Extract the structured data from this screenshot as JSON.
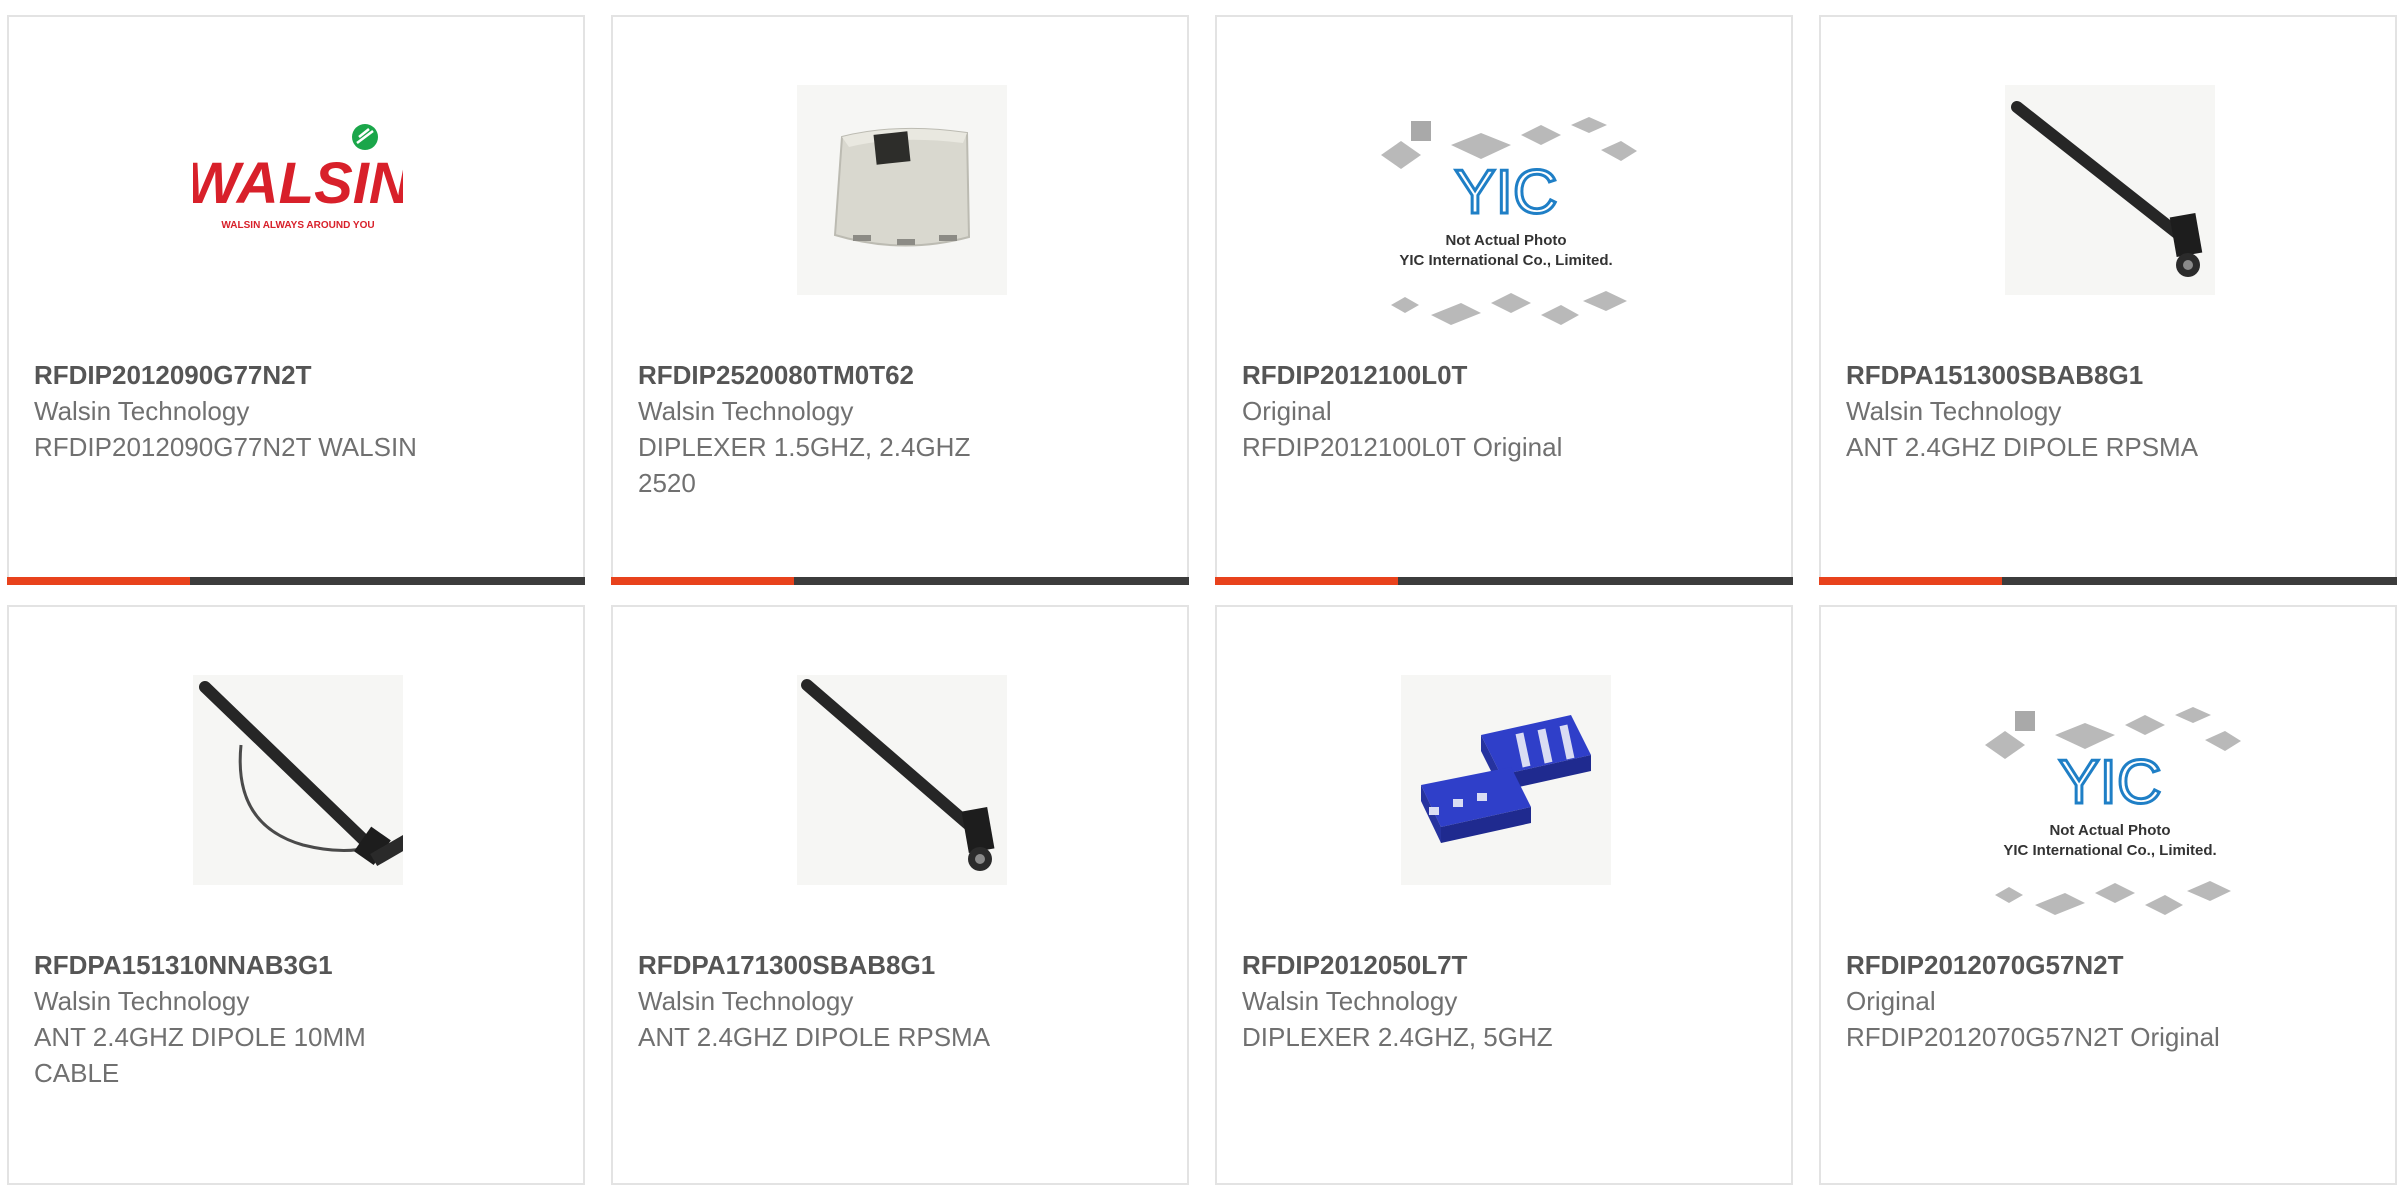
{
  "products": [
    {
      "part_number": "RFDIP2012090G77N2T",
      "manufacturer": "Walsin Technology",
      "description": "RFDIP2012090G77N2T WALSIN",
      "image": "walsin-logo",
      "logo": {
        "text": "WALSIN",
        "tagline": "WALSIN ALWAYS AROUND YOU"
      }
    },
    {
      "part_number": "RFDIP2520080TM0T62",
      "manufacturer": "Walsin Technology",
      "description": "DIPLEXER 1.5GHZ, 2.4GHZ 2520",
      "image": "ceramic-chip"
    },
    {
      "part_number": "RFDIP2012100L0T",
      "manufacturer": "Original",
      "description": "RFDIP2012100L0T Original",
      "image": "placeholder-yic",
      "placeholder": {
        "logo": "YIC",
        "line1": "Not Actual Photo",
        "line2": "YIC International Co., Limited."
      }
    },
    {
      "part_number": "RFDPA151300SBAB8G1",
      "manufacturer": "Walsin Technology",
      "description": "ANT 2.4GHZ DIPOLE RPSMA",
      "image": "dipole-antenna"
    },
    {
      "part_number": "RFDPA151310NNAB3G1",
      "manufacturer": "Walsin Technology",
      "description": "ANT 2.4GHZ DIPOLE 10MM CABLE",
      "image": "dipole-antenna-cable"
    },
    {
      "part_number": "RFDPA171300SBAB8G1",
      "manufacturer": "Walsin Technology",
      "description": "ANT 2.4GHZ DIPOLE RPSMA",
      "image": "dipole-antenna"
    },
    {
      "part_number": "RFDIP2012050L7T",
      "manufacturer": "Walsin Technology",
      "description": "DIPLEXER 2.4GHZ, 5GHZ",
      "image": "blue-chips"
    },
    {
      "part_number": "RFDIP2012070G57N2T",
      "manufacturer": "Original",
      "description": "RFDIP2012070G57N2T Original",
      "image": "placeholder-yic",
      "placeholder": {
        "logo": "YIC",
        "line1": "Not Actual Photo",
        "line2": "YIC International Co., Limited."
      }
    }
  ],
  "colors": {
    "accent": "#e8421c",
    "bar": "#3c3c3c",
    "card_border": "#e3e3e3",
    "walsin_red": "#d8202a",
    "walsin_green": "#1aa64a",
    "yic_blue": "#1f7fc6",
    "chip_blue": "#2f3fc9"
  }
}
